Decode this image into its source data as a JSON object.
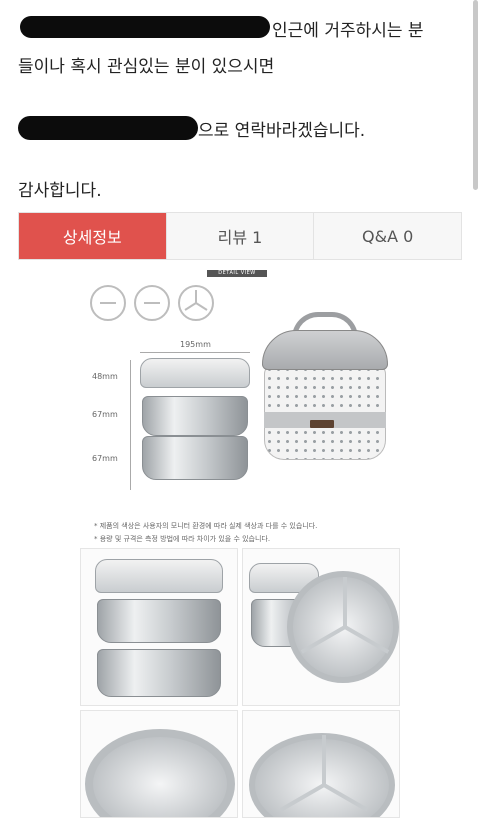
{
  "post": {
    "line1": "인근에 거주하시는 분",
    "line2": "들이나 혹시 관심있는 분이 있으시면",
    "line3": "으로 연락바라겠습니다.",
    "line4": "감사합니다."
  },
  "tabs": [
    {
      "label": "상세정보",
      "active": true
    },
    {
      "label": "리뷰  1",
      "active": false
    },
    {
      "label": "Q&A  0",
      "active": false
    }
  ],
  "detail": {
    "label": "DETAIL VIEW",
    "width_label": "195mm",
    "heights": [
      "48mm",
      "67mm",
      "67mm"
    ],
    "note1": "* 제품의 색상은 사용자의 모니터 환경에 따라 실제 색상과 다를 수 있습니다.",
    "note2": "* 용량 및 규격은 측정 방법에 따라 차이가 있을 수 있습니다."
  },
  "colors": {
    "accent": "#e0524d",
    "tab_bg": "#f7f7f7"
  }
}
